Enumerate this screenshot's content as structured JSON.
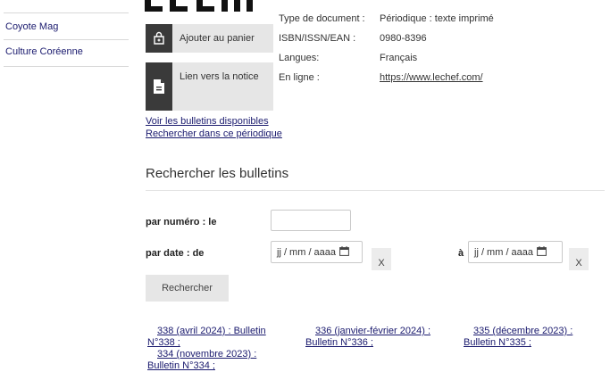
{
  "sidebar": {
    "items": [
      {
        "label": "Coyote Mag"
      },
      {
        "label": "Culture Coréenne"
      }
    ]
  },
  "logo": {
    "text": "LE CHEF"
  },
  "actions": {
    "add_to_cart": "Ajouter au panier",
    "notice_link": "Lien vers la notice"
  },
  "meta": [
    {
      "label": "Type de document :",
      "value": "Périodique : texte imprimé"
    },
    {
      "label": "ISBN/ISSN/EAN :",
      "value": "0980-8396"
    },
    {
      "label": "Langues:",
      "value": "Français"
    },
    {
      "label": "En ligne :",
      "value": "https://www.lechef.com/"
    }
  ],
  "links": {
    "bulletins": "Voir les bulletins disponibles",
    "search_periodical": "Rechercher dans ce périodique"
  },
  "search": {
    "title": "Rechercher les bulletins",
    "by_number_label": "par numéro : le",
    "number_value": "",
    "by_date_label": "par date : de",
    "to_label": "à",
    "date_placeholder": "jj / mm / aaaa",
    "clear_label": "X",
    "submit_label": "Rechercher"
  },
  "bulletins": [
    {
      "line1": "338 (avril 2024) : Bulletin",
      "line2": "N°338 ;"
    },
    {
      "line1": "336 (janvier-février 2024) :",
      "line2": "Bulletin N°336 ;"
    },
    {
      "line1": "335 (décembre 2023) :",
      "line2": "Bulletin N°335 ;"
    },
    {
      "line1": "334 (novembre 2023) :",
      "line2": "Bulletin N°334 ;"
    }
  ]
}
